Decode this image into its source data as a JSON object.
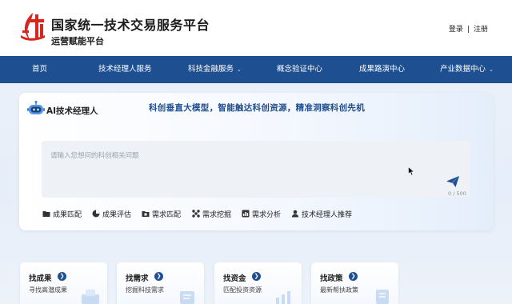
{
  "header": {
    "title": "国家统一技术交易服务平台",
    "subtitle": "运营赋能平台",
    "login": "登录",
    "separator": "|",
    "register": "注册"
  },
  "nav": {
    "items": [
      {
        "label": "首页",
        "has_dropdown": false
      },
      {
        "label": "技术经理人服务",
        "has_dropdown": false
      },
      {
        "label": "科技金融服务",
        "has_dropdown": true
      },
      {
        "label": "概念验证中心",
        "has_dropdown": false
      },
      {
        "label": "成果路演中心",
        "has_dropdown": false
      },
      {
        "label": "产业数据中心",
        "has_dropdown": true
      }
    ]
  },
  "ai": {
    "title": "AI技术经理人",
    "slogan": "科创垂直大模型，智能触达科创资源，精准洞察科创先机",
    "placeholder": "请输入您想问的科创相关问题",
    "counter": "0 / 500",
    "tools": [
      {
        "label": "成果匹配",
        "icon": "folder-icon"
      },
      {
        "label": "成果评估",
        "icon": "pie-chart-icon"
      },
      {
        "label": "需求匹配",
        "icon": "folder-icon"
      },
      {
        "label": "需求挖掘",
        "icon": "network-icon"
      },
      {
        "label": "需求分析",
        "icon": "bar-chart-icon"
      },
      {
        "label": "技术经理人推荐",
        "icon": "user-icon"
      }
    ]
  },
  "tiles": [
    {
      "title": "找成果",
      "sub": "寻找高潜成果"
    },
    {
      "title": "找需求",
      "sub": "挖掘科技需求"
    },
    {
      "title": "找资金",
      "sub": "匹配投资资源"
    },
    {
      "title": "找政策",
      "sub": "最新帮扶政策"
    }
  ],
  "colors": {
    "nav_bg": "#1e4f91",
    "accent": "#1f4f90",
    "logo_red": "#d7261e"
  }
}
